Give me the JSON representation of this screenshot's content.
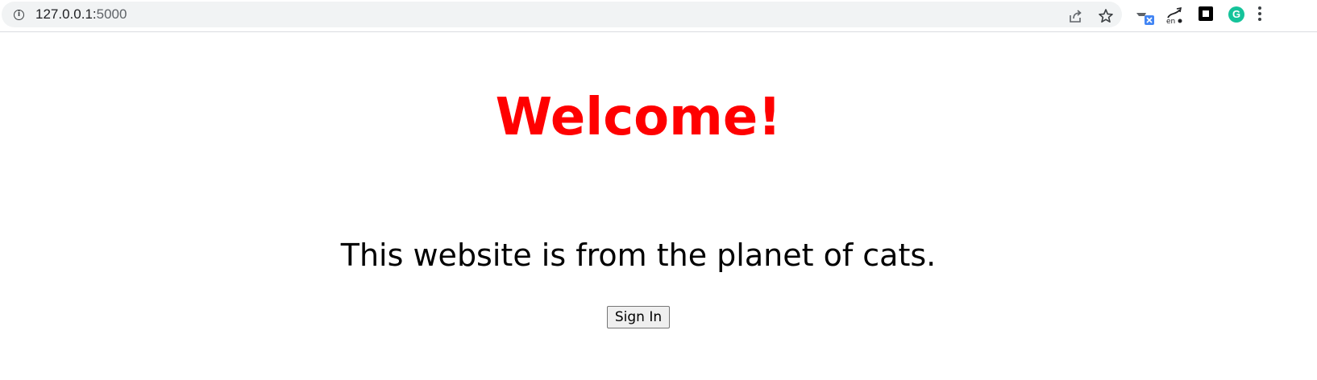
{
  "browser": {
    "url_host": "127.0.0.1:",
    "url_port": "5000",
    "icons": {
      "site_info": "info-icon",
      "share": "share-icon",
      "bookmark": "star-icon",
      "extensions": [
        "translate-extension-icon",
        "dictionary-extension-icon",
        "square-extension-icon",
        "grammarly-icon"
      ],
      "menu": "kebab-menu-icon"
    },
    "grammarly_glyph": "G"
  },
  "page": {
    "title": "Welcome!",
    "title_color": "#ff0000",
    "tagline": "This website is from the planet of cats.",
    "signin_label": "Sign In"
  }
}
